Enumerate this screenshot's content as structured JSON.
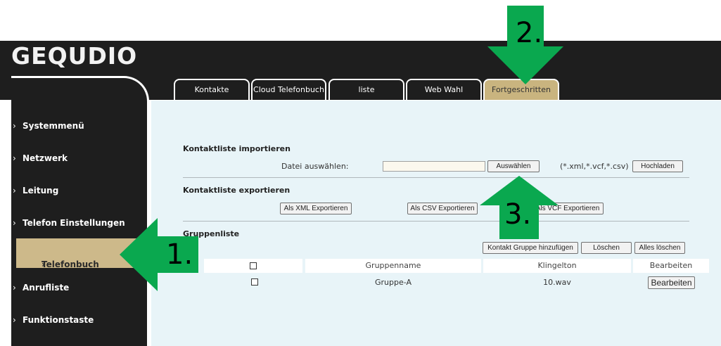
{
  "brand": {
    "logo_text": "GEQUDIO"
  },
  "tabs": [
    {
      "label": "Kontakte"
    },
    {
      "label": "Cloud Telefonbuch"
    },
    {
      "label": "liste"
    },
    {
      "label": "Web Wahl"
    },
    {
      "label": "Fortgeschritten"
    }
  ],
  "sidebar": {
    "items": [
      {
        "label": "Systemmenü"
      },
      {
        "label": "Netzwerk"
      },
      {
        "label": "Leitung"
      },
      {
        "label": "Telefon Einstellungen"
      },
      {
        "label": "Telefonbuch"
      },
      {
        "label": "Anrufliste"
      },
      {
        "label": "Funktionstaste"
      }
    ],
    "chevron": "›"
  },
  "import": {
    "title": "Kontaktliste importieren",
    "file_label": "Datei auswählen:",
    "file_value": "",
    "choose_button": "Auswählen",
    "formats": "(*.xml,*.vcf,*.csv)",
    "upload_button": "Hochladen"
  },
  "export": {
    "title": "Kontaktliste exportieren",
    "xml_button": "Als XML Exportieren",
    "csv_button": "Als CSV Exportieren",
    "vcf_button": "Als VCF Exportieren"
  },
  "groups": {
    "title": "Gruppenliste",
    "add_button": "Kontakt Gruppe hinzufügen",
    "delete_button": "Löschen",
    "delete_all_button": "Alles löschen",
    "columns": [
      "Gruppenname",
      "Klingelton",
      "Bearbeiten"
    ],
    "rows": [
      {
        "name": "Gruppe-A",
        "ringtone": "10.wav",
        "action": "Bearbeiten"
      }
    ]
  },
  "annotations": {
    "step1": "1.",
    "step2": "2.",
    "step3": "3.",
    "arrow_color": "#0aa84f"
  }
}
